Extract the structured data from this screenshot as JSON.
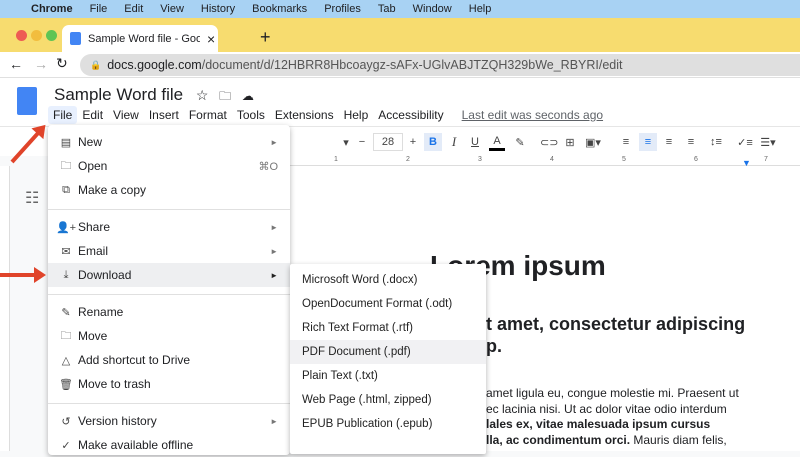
{
  "mac_menu": [
    "Chrome",
    "File",
    "Edit",
    "View",
    "History",
    "Bookmarks",
    "Profiles",
    "Tab",
    "Window",
    "Help"
  ],
  "tab": {
    "title": "Sample Word file - Google Doc",
    "close": "×",
    "new": "+"
  },
  "address": {
    "host": "docs.google.com",
    "path": "/document/d/12HBRR8Hbcoaygz-sAFx-UGlvABJTZQH329bWe_RBYRI/edit"
  },
  "doc": {
    "title": "Sample Word file",
    "menus": [
      "File",
      "Edit",
      "View",
      "Insert",
      "Format",
      "Tools",
      "Extensions",
      "Help",
      "Accessibility"
    ],
    "last_edit": "Last edit was seconds ago"
  },
  "toolbar": {
    "font_size": "28",
    "minus": "−",
    "plus": "+"
  },
  "ruler": [
    "1",
    "2",
    "3",
    "4",
    "5",
    "6",
    "7"
  ],
  "file_menu": [
    {
      "label": "New",
      "icon": "▤",
      "right": "►"
    },
    {
      "label": "Open",
      "icon": "🗀",
      "right": "⌘O"
    },
    {
      "label": "Make a copy",
      "icon": "⧉",
      "right": ""
    },
    {
      "label": "Share",
      "icon": "👤+",
      "right": "►"
    },
    {
      "label": "Email",
      "icon": "✉",
      "right": "►"
    },
    {
      "label": "Download",
      "icon": "⤓",
      "right": "►"
    },
    {
      "label": "Rename",
      "icon": "✎",
      "right": ""
    },
    {
      "label": "Move",
      "icon": "🗀",
      "right": ""
    },
    {
      "label": "Add shortcut to Drive",
      "icon": "△",
      "right": ""
    },
    {
      "label": "Move to trash",
      "icon": "🗑",
      "right": ""
    },
    {
      "label": "Version history",
      "icon": "↺",
      "right": "►"
    },
    {
      "label": "Make available offline",
      "icon": "✓",
      "right": ""
    }
  ],
  "download_menu": [
    "Microsoft Word (.docx)",
    "OpenDocument Format (.odt)",
    "Rich Text Format (.rtf)",
    "PDF Document (.pdf)",
    "Plain Text (.txt)",
    "Web Page (.html, zipped)",
    "EPUB Publication (.epub)"
  ],
  "content": {
    "h1": "Lorem ipsum",
    "h2a": "t amet, consectetur adipiscing",
    "h2b": "p.",
    "body1": "amet ligula eu, congue molestie mi. Praesent ut",
    "body2": "ec lacinia nisi. Ut ac dolor vitae odio interdum",
    "body3": "lales ex, vitae malesuada ipsum cursus",
    "body4a": "lla, ac condimentum orci.",
    "body4b": " Mauris diam felis,"
  }
}
